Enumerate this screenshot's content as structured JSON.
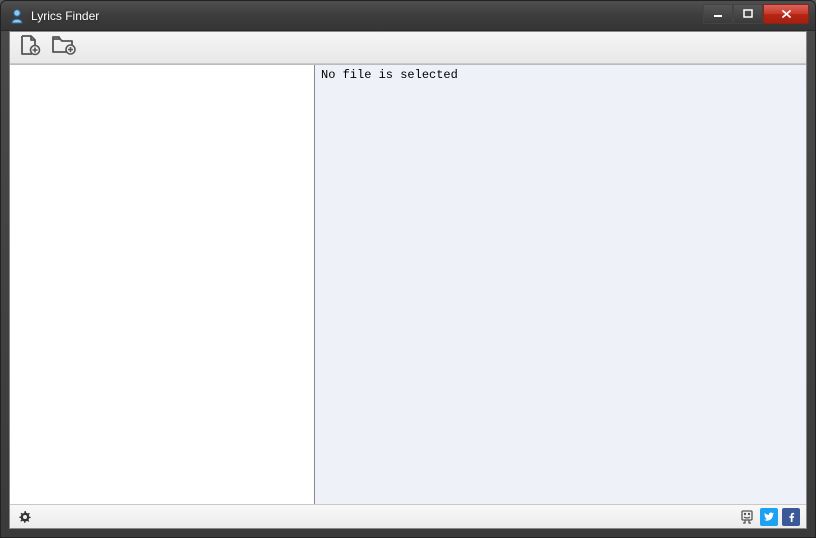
{
  "window": {
    "title": "Lyrics Finder"
  },
  "content": {
    "empty_message": "No file is selected"
  }
}
